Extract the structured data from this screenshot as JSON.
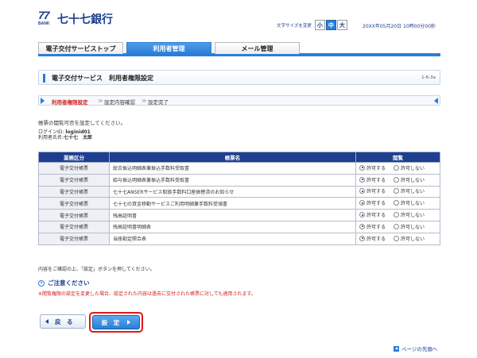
{
  "header": {
    "logo_num": "77",
    "logo_bank": "BANK",
    "logo_name": "七十七銀行",
    "font_size_label": "文字サイズを変更",
    "font_sizes": [
      "小",
      "中",
      "大"
    ],
    "font_size_selected": "中",
    "datetime": "20XX年05月20日 10時00分00秒"
  },
  "tabs": [
    {
      "label": "電子交付サービストップ",
      "active": false
    },
    {
      "label": "利用者管理",
      "active": true
    },
    {
      "label": "メール管理",
      "active": false
    }
  ],
  "page": {
    "title": "電子交付サービス　利用者権限設定",
    "page_no": "1-6-3a"
  },
  "steps": [
    "利用者権限設定",
    "設定内容確認",
    "設定完了"
  ],
  "steps_current": 0,
  "instruction": "帳票の閲覧可否を設定してください。",
  "login": {
    "id_label": "ログインID:",
    "id_value": "loginid01",
    "name_label": "利用者氏名:",
    "name_value": "七十七　太郎"
  },
  "table": {
    "headers": [
      "業務区分",
      "帳票名",
      "閲覧"
    ],
    "radio_labels": [
      "許可する",
      "許可しない"
    ],
    "rows": [
      {
        "category": "電子交付帳票",
        "name": "総合振込明細表兼振込手数料受取書",
        "allowed": true
      },
      {
        "category": "電子交付帳票",
        "name": "給与振込明細表兼振込手数料受取書",
        "allowed": true
      },
      {
        "category": "電子交付帳票",
        "name": "七十七ANSERサービス取扱手数料口座振替済のお知らせ",
        "allowed": true
      },
      {
        "category": "電子交付帳票",
        "name": "七十七の資金移動サービスご利用明細兼手数料受領書",
        "allowed": true
      },
      {
        "category": "電子交付帳票",
        "name": "残高証明書",
        "allowed": true
      },
      {
        "category": "電子交付帳票",
        "name": "残高証明書明細表",
        "allowed": true
      },
      {
        "category": "電子交付帳票",
        "name": "当座勘定照合表",
        "allowed": true
      }
    ]
  },
  "confirm_text": "内容をご確認の上、「設定」ボタンを押してください。",
  "caution": {
    "title": "ご注意ください",
    "text": "※閲覧権限の設定を変更した場合、設定された内容は過去に交付された帳票に対しても適用されます。"
  },
  "buttons": {
    "back": "戻　る",
    "set": "設　定"
  },
  "page_top": "ページの先頭へ",
  "colors": {
    "primary": "#2a7ed8",
    "navy": "#1e3f8f",
    "alert": "#d21e1e"
  }
}
